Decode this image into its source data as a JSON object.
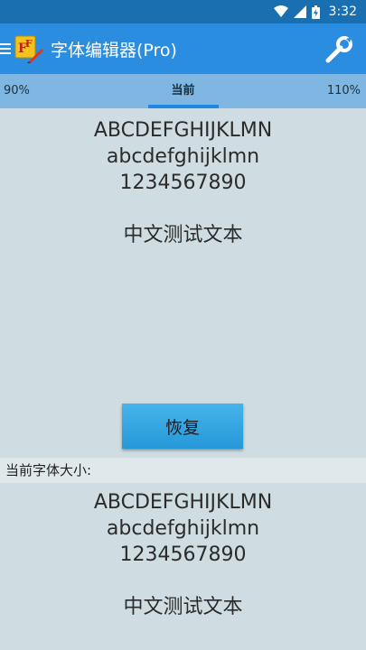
{
  "status": {
    "time": "3:32"
  },
  "appbar": {
    "title": "字体编辑器(Pro)"
  },
  "tabs": {
    "left": "90%",
    "center": "当前",
    "right": "110%"
  },
  "preview": {
    "upper": "ABCDEFGHIJKLMN",
    "lower": "abcdefghijklmn",
    "digits": "1234567890",
    "chinese": "中文测试文本"
  },
  "button": {
    "restore": "恢复"
  },
  "current_section": {
    "label": "当前字体大小:",
    "upper": "ABCDEFGHIJKLMN",
    "lower": "abcdefghijklmn",
    "digits": "1234567890",
    "chinese": "中文测试文本"
  },
  "colors": {
    "status_bar": "#1a6fb0",
    "app_bar": "#2a8de0",
    "tab_bar": "#7fb6e2",
    "accent": "#1e88e5",
    "background": "#cfdde2"
  },
  "icons": [
    "wifi-icon",
    "signal-icon",
    "battery-icon",
    "menu-icon",
    "app-logo-icon",
    "wrench-icon"
  ]
}
